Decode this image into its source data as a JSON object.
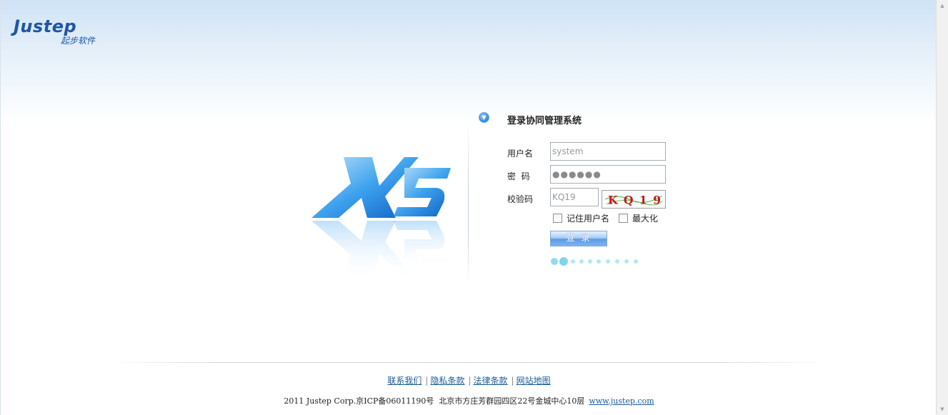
{
  "brand": {
    "wordmark": "Justep",
    "subtitle": "起步软件",
    "product_mark": "X5",
    "color": "#1f55a6"
  },
  "login": {
    "title": "登录协同管理系统",
    "username_label": "用户名",
    "username_value": "system",
    "password_label": "密  码",
    "password_value": "●●●●●●",
    "captcha_label": "校验码",
    "captcha_value": "KQ19",
    "captcha_image_text": "KQ19",
    "remember_label": "记住用户名",
    "maximize_label": "最大化",
    "login_button": "登录",
    "toggle_icon": "arrow-down-circle-icon"
  },
  "footer": {
    "links": [
      "联系我们",
      "隐私条款",
      "法律条款",
      "网站地图"
    ],
    "separator": "|",
    "copyright": "2011 Justep Corp.京ICP备06011190号  北京市方庄芳群园四区22号金城中心10层",
    "website": "www.justep.com"
  },
  "colors": {
    "link": "#1a5a96",
    "button": "#5b9ae4",
    "progress_dot": "#aee9f4"
  }
}
